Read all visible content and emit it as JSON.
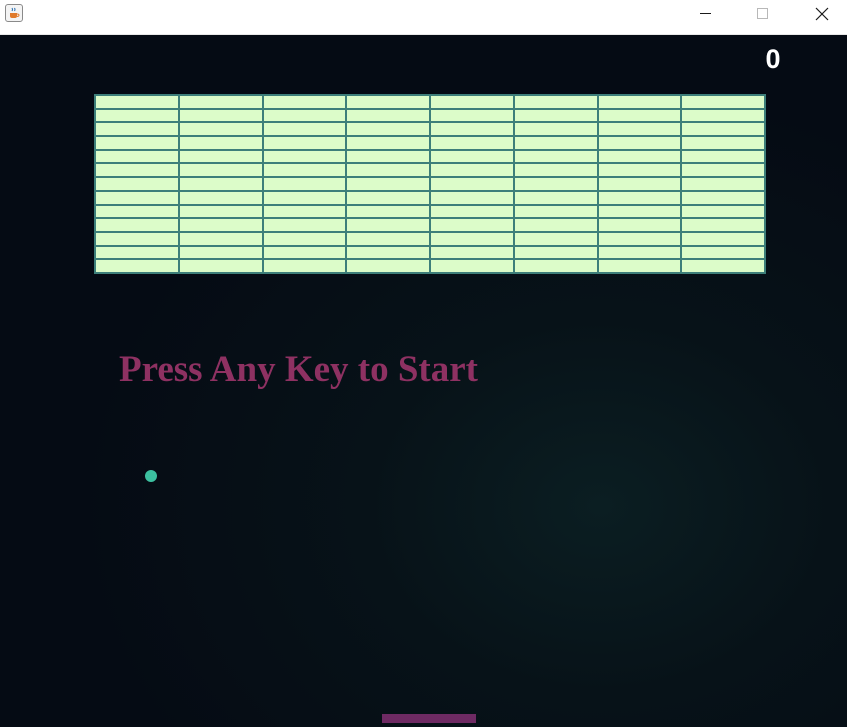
{
  "window": {
    "icon": "java-cup-icon",
    "controls": {
      "minimize_icon": "minimize-icon",
      "maximize_icon": "maximize-icon",
      "close_icon": "close-icon"
    }
  },
  "game": {
    "score": "0",
    "message": "Press Any Key to Start",
    "bricks": {
      "rows": 13,
      "columns": 8,
      "fill_color": "#dcfcc9",
      "border_color": "#3d7f7a"
    },
    "ball_color": "#3cc0a0",
    "paddle_color": "#6e2a63",
    "message_color": "#8e3162",
    "background_color": "#050b14"
  }
}
